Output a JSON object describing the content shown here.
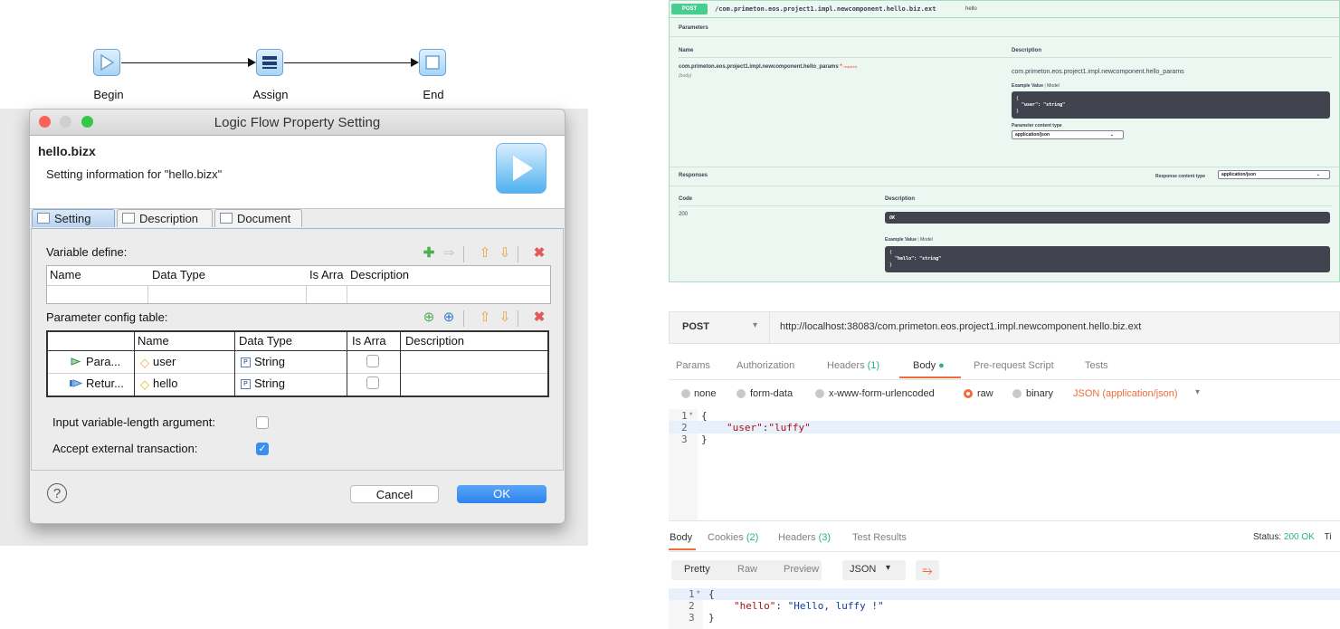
{
  "flow": {
    "nodes": [
      {
        "label": "Begin"
      },
      {
        "label": "Assign"
      },
      {
        "label": "End"
      }
    ]
  },
  "dialog": {
    "title": "Logic Flow Property Setting",
    "header_title": "hello.bizx",
    "header_subtitle": "Setting information for \"hello.bizx\"",
    "tabs": [
      {
        "label": "Setting",
        "active": true
      },
      {
        "label": "Description",
        "active": false
      },
      {
        "label": "Document",
        "active": false
      }
    ],
    "variable_define": {
      "label": "Variable define:",
      "columns": [
        "Name",
        "Data Type",
        "Is Arra",
        "Description"
      ]
    },
    "parameter_table": {
      "label": "Parameter config table:",
      "columns": [
        "",
        "Name",
        "Data Type",
        "Is Arra",
        "Description"
      ],
      "rows": [
        {
          "kind": "Para...",
          "name": "user",
          "type": "String",
          "is_array": false,
          "description": ""
        },
        {
          "kind": "Retur...",
          "name": "hello",
          "type": "String",
          "is_array": false,
          "description": ""
        }
      ]
    },
    "options": [
      {
        "label": "Input variable-length argument:",
        "checked": false
      },
      {
        "label": "Accept external transaction:",
        "checked": true
      }
    ],
    "help_symbol": "?",
    "cancel_label": "Cancel",
    "ok_label": "OK",
    "colors": {
      "ok": "#3b8ef0",
      "traffic_red": "#fc605b",
      "traffic_gray": "#cfcfcf",
      "traffic_green": "#34c84a"
    }
  },
  "swagger": {
    "method": "POST",
    "path": "/com.primeton.eos.project1.impl.newcomponent.hello.biz.ext",
    "summary": "hello",
    "parameters_title": "Parameters",
    "col_name": "Name",
    "col_description": "Description",
    "param_name": "com.primeton.eos.project1.impl.newcomponent.hello_params",
    "required_mark": "*",
    "required_text": "required",
    "param_in": "(body)",
    "param_desc": "com.primeton.eos.project1.impl.newcomponent.hello_params",
    "example_value": "Example Value",
    "model": "Model",
    "request_example": [
      "{",
      "  \"user\": \"string\"",
      "}"
    ],
    "param_content_type_label": "Parameter content type",
    "param_content_type": "application/json",
    "responses_title": "Responses",
    "response_content_type_label": "Response content type",
    "response_content_type": "application/json",
    "col_code": "Code",
    "code": "200",
    "ok_text": "OK",
    "response_example": [
      "{",
      "  \"hello\": \"string\"",
      "}"
    ],
    "colors": {
      "post": "#49cc90",
      "background": "#ecf7f1"
    }
  },
  "postman": {
    "method": "POST",
    "url": "http://localhost:38083/com.primeton.eos.project1.impl.newcomponent.hello.biz.ext",
    "req_tabs": [
      {
        "label": "Params"
      },
      {
        "label": "Authorization"
      },
      {
        "label": "Headers",
        "count": "(1)"
      },
      {
        "label": "Body",
        "active": true
      },
      {
        "label": "Pre-request Script"
      },
      {
        "label": "Tests"
      }
    ],
    "body_modes": [
      "none",
      "form-data",
      "x-www-form-urlencoded",
      "raw",
      "binary"
    ],
    "body_mode_selected": "raw",
    "content_type": "JSON (application/json)",
    "request_code": [
      {
        "num": "1",
        "text": "{"
      },
      {
        "num": "2",
        "key": "\"user\"",
        "colon": ":",
        "value": "\"luffy\""
      },
      {
        "num": "3",
        "text": "}"
      }
    ],
    "resp_tabs": [
      {
        "label": "Body",
        "active": true
      },
      {
        "label": "Cookies",
        "count": "(2)"
      },
      {
        "label": "Headers",
        "count": "(3)"
      },
      {
        "label": "Test Results"
      }
    ],
    "status_label": "Status:",
    "status_value": "200 OK",
    "status_trail": "Ti",
    "view_modes": [
      "Pretty",
      "Raw",
      "Preview"
    ],
    "format": "JSON",
    "response_code": [
      {
        "num": "1",
        "text": "{"
      },
      {
        "num": "2",
        "key": "\"hello\"",
        "colon": ": ",
        "value": "\"Hello, luffy !\""
      },
      {
        "num": "3",
        "text": "}"
      }
    ],
    "colors": {
      "accent": "#f26b3a",
      "green": "#26b47f"
    }
  }
}
